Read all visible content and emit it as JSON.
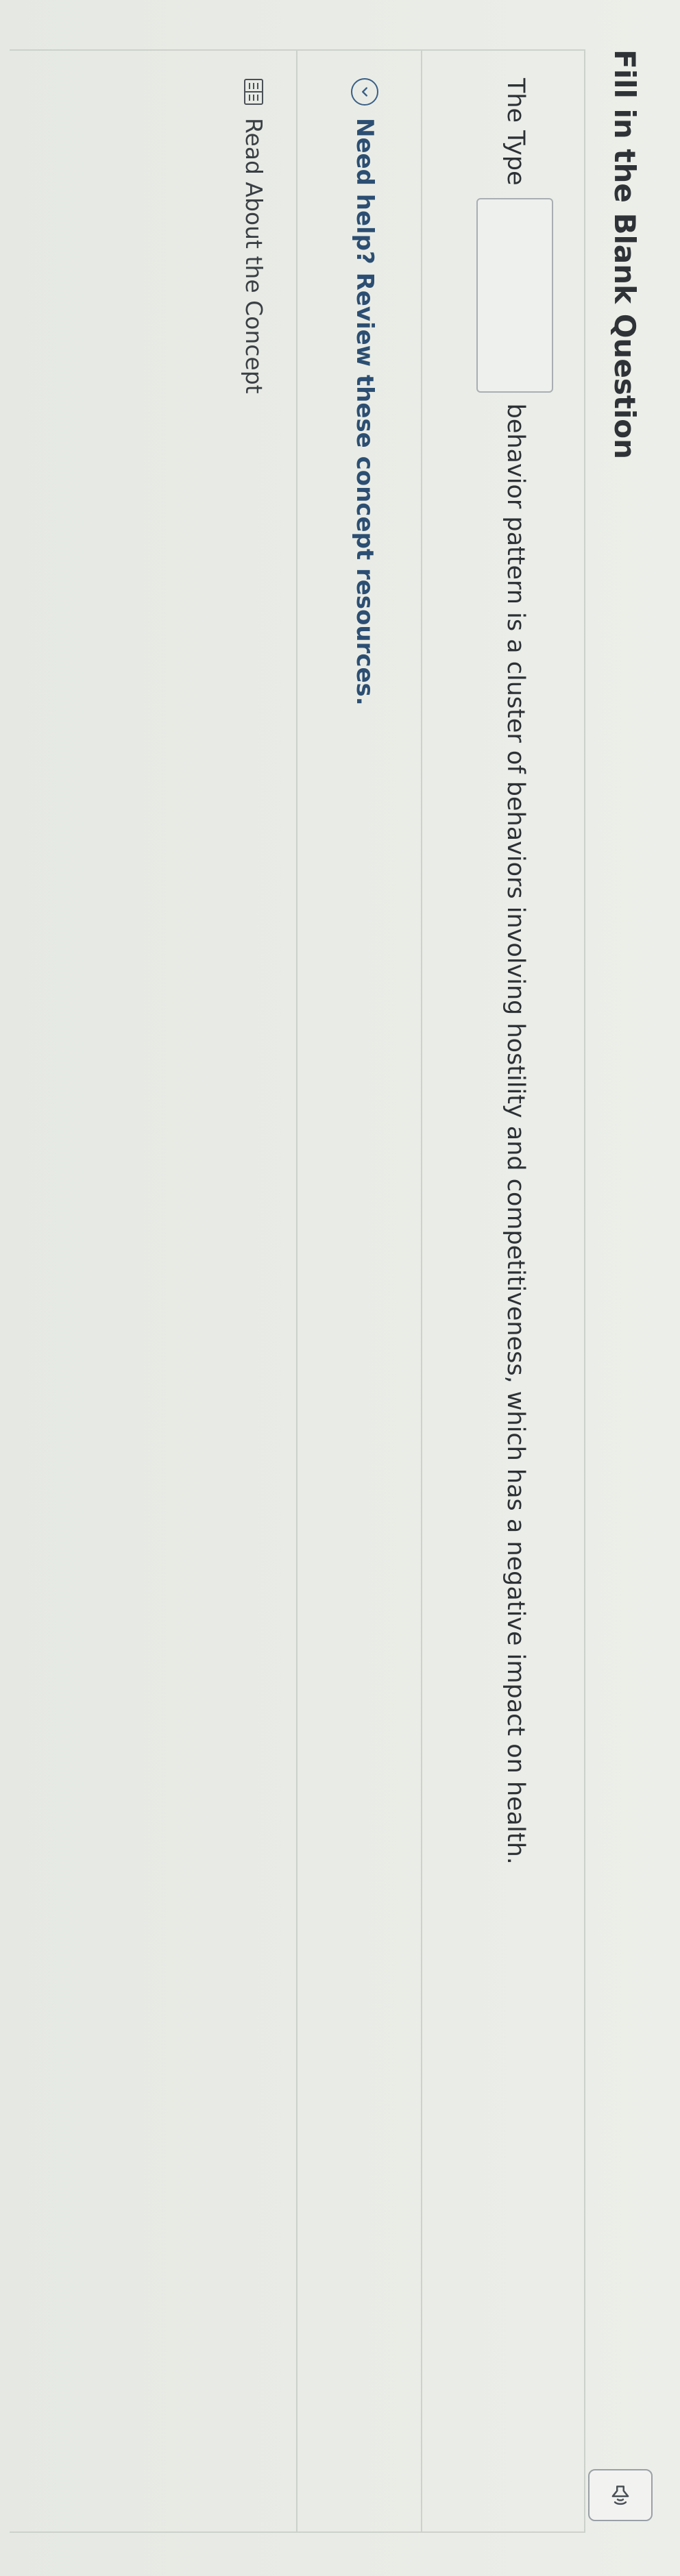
{
  "question_header": {
    "title": "Fill in the Blank Question"
  },
  "question": {
    "text_before": "The Type",
    "blank_value": "",
    "text_after": "behavior pattern is a cluster of behaviors involving hostility and competitiveness, which has a negative impact on health."
  },
  "help": {
    "toggle_label": "Need help? Review these concept resources.",
    "resources": [
      {
        "label": "Read About the Concept",
        "icon": "book-icon"
      }
    ]
  },
  "icons": {
    "audio": "speaker-icon",
    "toggle": "chevron-down-icon"
  },
  "colors": {
    "link_blue": "#2c4e72",
    "text": "#2d3135"
  }
}
